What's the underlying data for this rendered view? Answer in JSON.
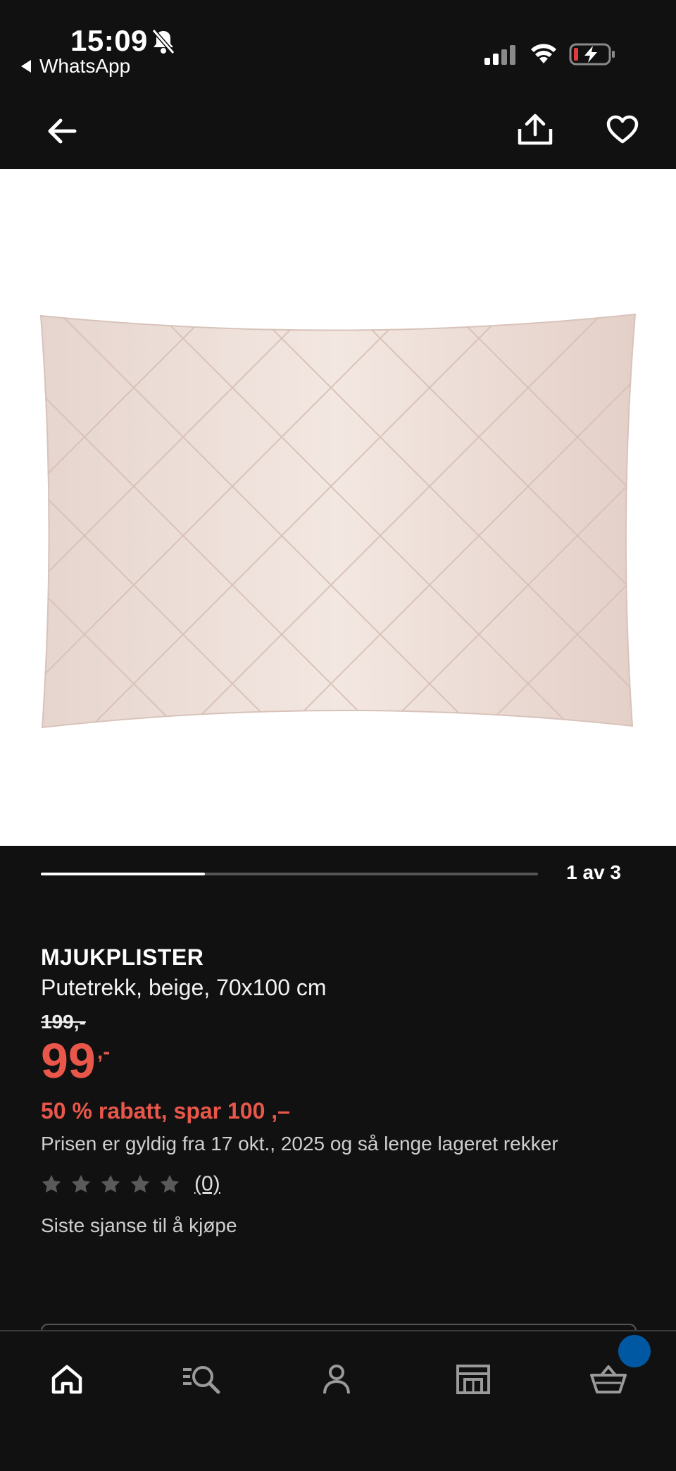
{
  "status_bar": {
    "time": "15:09",
    "back_app": "WhatsApp"
  },
  "top_nav": {
    "back_icon": "arrow-left-icon",
    "share_icon": "share-icon",
    "favorite_icon": "heart-icon"
  },
  "gallery": {
    "current": 1,
    "total": 3,
    "label": "1 av 3",
    "progress": 0.33
  },
  "product": {
    "name": "MJUKPLISTER",
    "description": "Putetrekk, beige, 70x100 cm",
    "old_price": "199,-",
    "price": "99",
    "price_suffix": ",-",
    "discount": "50 % rabatt, spar 100 ,–",
    "validity": "Prisen er gyldig fra 17 okt., 2025 og så lenge lageret rekker",
    "rating_stars": 0,
    "rating_count": "(0)",
    "availability": "Siste sjanse til å kjøpe"
  },
  "tab_bar": {
    "tabs": [
      "home-icon",
      "search-icon",
      "profile-icon",
      "store-icon",
      "cart-icon"
    ]
  },
  "colors": {
    "background": "#111111",
    "accent_red": "#e8574a",
    "badge_blue": "#0058a3"
  }
}
